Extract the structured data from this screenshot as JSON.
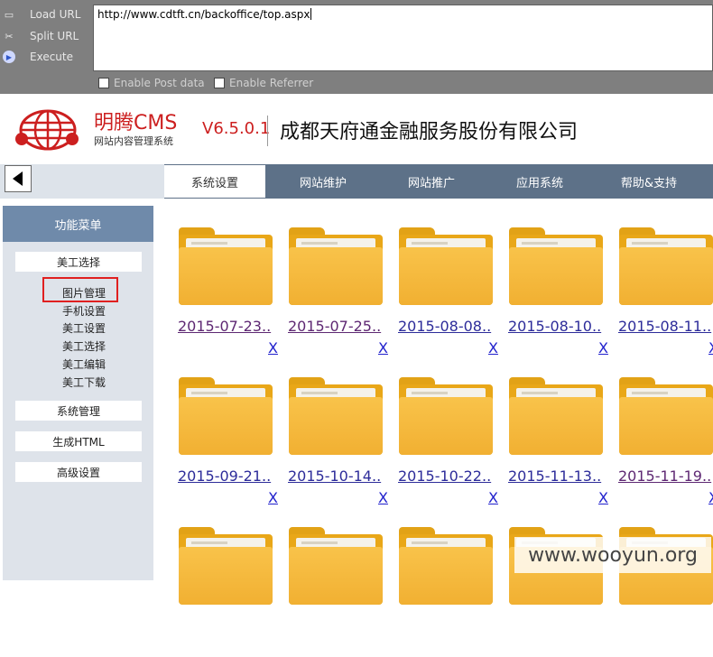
{
  "toolbar": {
    "load_url": "Load URL",
    "split_url": "Split URL",
    "execute": "Execute",
    "url_value": "http://www.cdtft.cn/backoffice/top.aspx",
    "enable_post": "Enable Post data",
    "enable_referrer": "Enable Referrer"
  },
  "header": {
    "brand": "明腾CMS",
    "brand_sub": "网站内容管理系统",
    "version": "V6.5.0.1",
    "company": "成都天府通金融服务股份有限公司"
  },
  "nav": {
    "tabs": [
      "系统设置",
      "网站维护",
      "网站推广",
      "应用系统",
      "帮助&支持"
    ],
    "active_index": 0
  },
  "sidebar": {
    "title": "功能菜单",
    "sections": [
      "美工选择",
      "系统管理",
      "生成HTML",
      "高级设置"
    ],
    "links": [
      "图片管理",
      "手机设置",
      "美工设置",
      "美工选择",
      "美工编辑",
      "美工下载"
    ]
  },
  "folders": [
    {
      "label": "2015-07-23..",
      "delete": "X"
    },
    {
      "label": "2015-07-25..",
      "delete": "X"
    },
    {
      "label": "2015-08-08..",
      "delete": "X"
    },
    {
      "label": "2015-08-10..",
      "delete": "X"
    },
    {
      "label": "2015-08-11..",
      "delete": "X"
    },
    {
      "label": "2015-09-21..",
      "delete": "X"
    },
    {
      "label": "2015-10-14..",
      "delete": "X"
    },
    {
      "label": "2015-10-22..",
      "delete": "X"
    },
    {
      "label": "2015-11-13..",
      "delete": "X"
    },
    {
      "label": "2015-11-19..",
      "delete": "X"
    },
    {
      "label": "",
      "delete": ""
    },
    {
      "label": "",
      "delete": ""
    },
    {
      "label": "",
      "delete": ""
    },
    {
      "label": "",
      "delete": ""
    },
    {
      "label": "",
      "delete": ""
    }
  ],
  "watermark": "www.wooyun.org",
  "colors": {
    "toolbar": "#7f7f7f",
    "brand_red": "#cc1f1f",
    "nav_bar": "#5d7188",
    "sidebar_head": "#6f8aaa",
    "sidebar_body": "#dee3ea",
    "folder": "#f1b032",
    "highlight": "#e02020"
  }
}
